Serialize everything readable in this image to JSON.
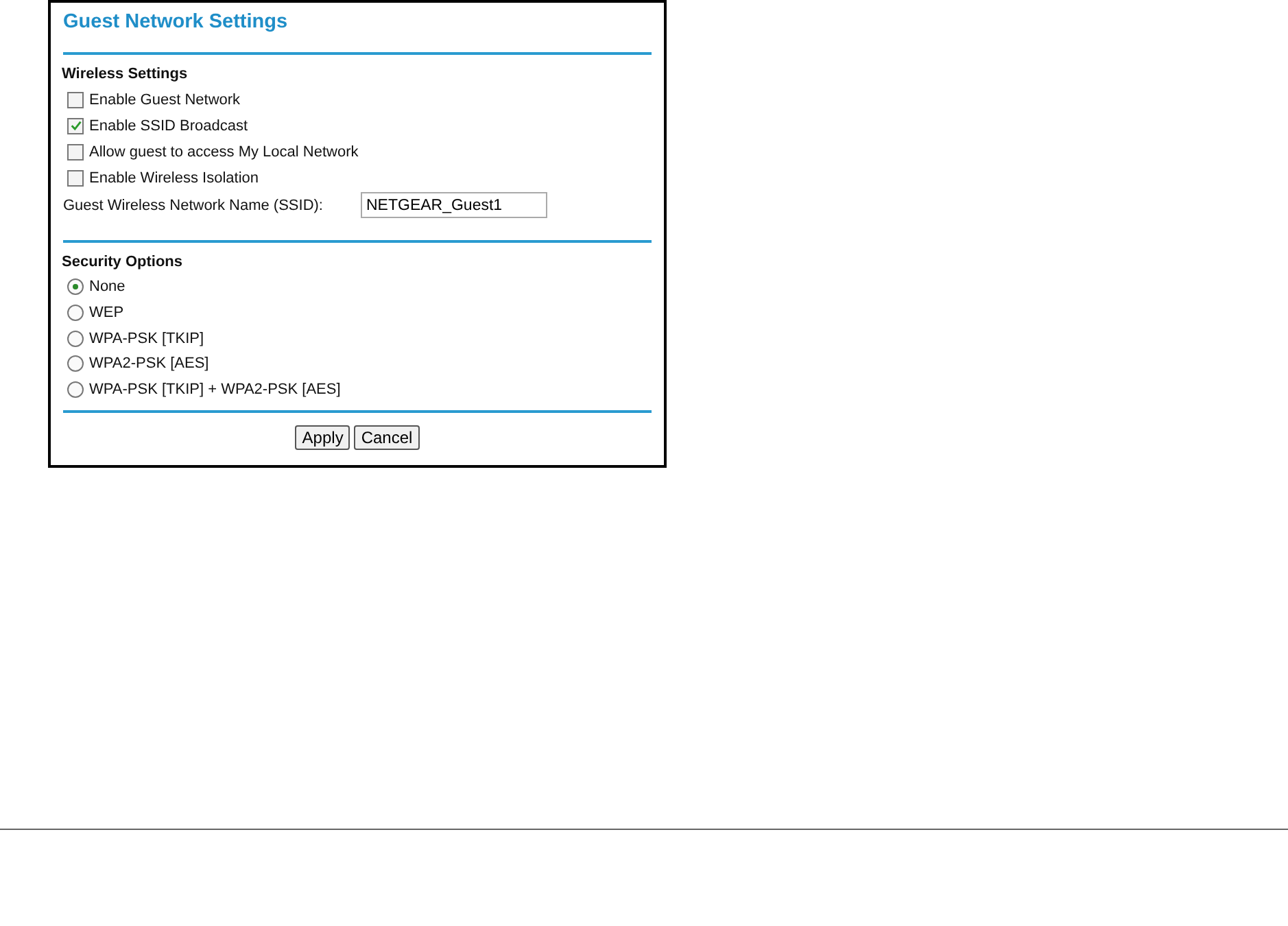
{
  "title": "Guest Network Settings",
  "wireless_settings": {
    "heading": "Wireless Settings",
    "options": [
      {
        "label": "Enable Guest Network",
        "checked": false
      },
      {
        "label": "Enable SSID Broadcast",
        "checked": true
      },
      {
        "label": "Allow guest to access My Local Network",
        "checked": false
      },
      {
        "label": "Enable Wireless Isolation",
        "checked": false
      }
    ],
    "ssid": {
      "label": "Guest Wireless Network Name (SSID):",
      "value": "NETGEAR_Guest1"
    }
  },
  "security_options": {
    "heading": "Security Options",
    "options": [
      {
        "label": "None",
        "selected": true
      },
      {
        "label": "WEP",
        "selected": false
      },
      {
        "label": "WPA-PSK [TKIP]",
        "selected": false
      },
      {
        "label": "WPA2-PSK [AES]",
        "selected": false
      },
      {
        "label": "WPA-PSK [TKIP] + WPA2-PSK [AES]",
        "selected": false
      }
    ]
  },
  "buttons": [
    "Apply",
    "Cancel"
  ]
}
